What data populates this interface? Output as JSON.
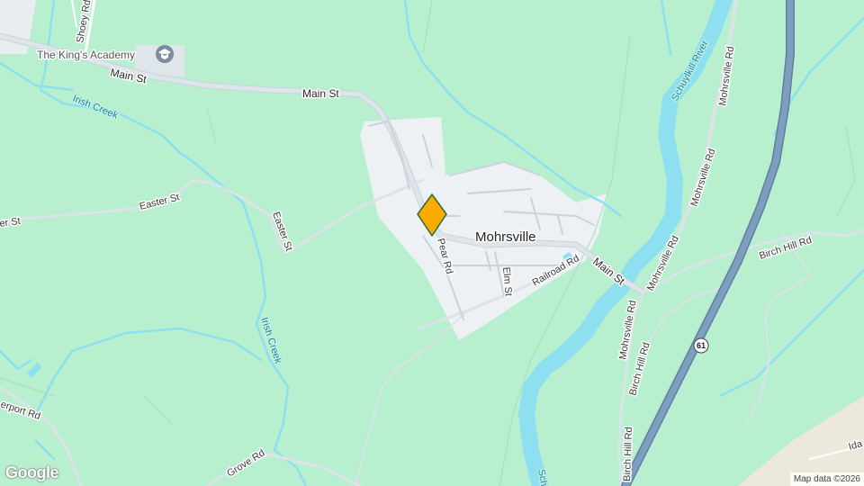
{
  "map": {
    "town_label": "Mohrsville",
    "poi": {
      "name": "The King's Academy",
      "icon": "school-icon"
    },
    "roads": {
      "main_st_1": "Main St",
      "main_st_2": "Main St",
      "main_st_3": "Main St",
      "shoey_rd": "Shoey Rd",
      "easter_st_1": "Easter St",
      "easter_st_2": "Easter St",
      "easter_st_partial": "er St",
      "pear_rd": "Pear Rd",
      "elm_st": "Elm St",
      "railroad_rd": "Railroad Rd",
      "mohrsville_rd_1": "Mohrsville Rd",
      "mohrsville_rd_2": "Mohrsville Rd",
      "mohrsville_rd_3": "Mohrsville Rd",
      "mohrsville_rd_4": "Mohrsville Rd",
      "birch_hill_rd_1": "Birch Hill Rd",
      "birch_hill_rd_2": "Birch Hill Rd",
      "birch_hill_rd_3": "Birch Hill Rd",
      "grove_rd": "Grove Rd",
      "perport_rd": "erport Rd",
      "ida_partial": "Ida"
    },
    "water": {
      "irish_creek_1": "Irish Creek",
      "irish_creek_2": "Irish Creek",
      "schuylkill_river": "Schuylkill River",
      "schuylkill_partial": "Sch"
    },
    "highway_shield": "61",
    "attribution": "Map data ©2026",
    "logo": "Google",
    "marker": {
      "icon": "location-pin-icon",
      "color": "#f9ab00"
    },
    "colors": {
      "land": "#b8f0cf",
      "urban": "#eef1f4",
      "water": "#8ee0f0",
      "highway": "#7a9bb8",
      "road": "#d6dee5"
    }
  }
}
